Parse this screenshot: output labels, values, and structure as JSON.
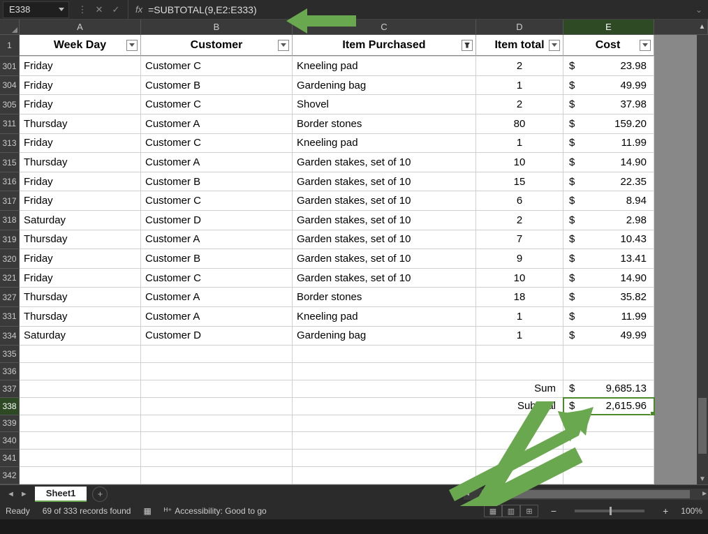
{
  "formulaBar": {
    "nameBox": "E338",
    "formula": "=SUBTOTAL(9,E2:E333)"
  },
  "columns": {
    "A": "A",
    "B": "B",
    "C": "C",
    "D": "D",
    "E": "E"
  },
  "headers": {
    "A": "Week Day",
    "B": "Customer",
    "C": "Item Purchased",
    "D": "Item total",
    "E": "Cost"
  },
  "rows": [
    {
      "n": "301",
      "a": "Friday",
      "b": "Customer C",
      "c": "Kneeling pad",
      "d": "2",
      "cost": "23.98"
    },
    {
      "n": "304",
      "a": "Friday",
      "b": "Customer B",
      "c": "Gardening bag",
      "d": "1",
      "cost": "49.99"
    },
    {
      "n": "305",
      "a": "Friday",
      "b": "Customer C",
      "c": "Shovel",
      "d": "2",
      "cost": "37.98"
    },
    {
      "n": "311",
      "a": "Thursday",
      "b": "Customer A",
      "c": "Border stones",
      "d": "80",
      "cost": "159.20"
    },
    {
      "n": "313",
      "a": "Friday",
      "b": "Customer C",
      "c": "Kneeling pad",
      "d": "1",
      "cost": "11.99"
    },
    {
      "n": "315",
      "a": "Thursday",
      "b": "Customer A",
      "c": "Garden stakes, set of 10",
      "d": "10",
      "cost": "14.90"
    },
    {
      "n": "316",
      "a": "Friday",
      "b": "Customer B",
      "c": "Garden stakes, set of 10",
      "d": "15",
      "cost": "22.35"
    },
    {
      "n": "317",
      "a": "Friday",
      "b": "Customer C",
      "c": "Garden stakes, set of 10",
      "d": "6",
      "cost": "8.94"
    },
    {
      "n": "318",
      "a": "Saturday",
      "b": "Customer D",
      "c": "Garden stakes, set of 10",
      "d": "2",
      "cost": "2.98"
    },
    {
      "n": "319",
      "a": "Thursday",
      "b": "Customer A",
      "c": "Garden stakes, set of 10",
      "d": "7",
      "cost": "10.43"
    },
    {
      "n": "320",
      "a": "Friday",
      "b": "Customer B",
      "c": "Garden stakes, set of 10",
      "d": "9",
      "cost": "13.41"
    },
    {
      "n": "321",
      "a": "Friday",
      "b": "Customer C",
      "c": "Garden stakes, set of 10",
      "d": "10",
      "cost": "14.90"
    },
    {
      "n": "327",
      "a": "Thursday",
      "b": "Customer A",
      "c": "Border stones",
      "d": "18",
      "cost": "35.82"
    },
    {
      "n": "331",
      "a": "Thursday",
      "b": "Customer A",
      "c": "Kneeling pad",
      "d": "1",
      "cost": "11.99"
    },
    {
      "n": "334",
      "a": "Saturday",
      "b": "Customer D",
      "c": "Gardening bag",
      "d": "1",
      "cost": "49.99"
    }
  ],
  "emptyRows1": [
    "335",
    "336"
  ],
  "summary": {
    "sumRow": {
      "n": "337",
      "label": "Sum",
      "cost": "9,685.13"
    },
    "subtotalRow": {
      "n": "338",
      "label": "Subtotal",
      "cost": "2,615.96"
    }
  },
  "emptyRows2": [
    "339",
    "340",
    "341",
    "342"
  ],
  "currency": "$",
  "tabs": {
    "sheet1": "Sheet1"
  },
  "status": {
    "ready": "Ready",
    "records": "69 of 333 records found",
    "accessibility": "Accessibility: Good to go",
    "zoom": "100%"
  }
}
